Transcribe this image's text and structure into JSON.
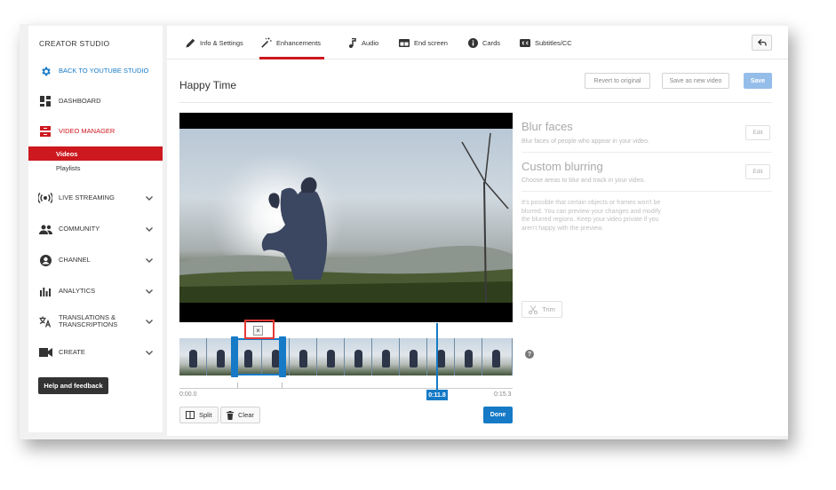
{
  "sidebar": {
    "title": "CREATOR STUDIO",
    "back_link": "BACK TO YOUTUBE STUDIO",
    "dashboard": "DASHBOARD",
    "video_manager": "VIDEO MANAGER",
    "videos": "Videos",
    "playlists": "Playlists",
    "live_streaming": "LIVE STREAMING",
    "community": "COMMUNITY",
    "channel": "CHANNEL",
    "analytics": "ANALYTICS",
    "translations_line1": "TRANSLATIONS &",
    "translations_line2": "TRANSCRIPTIONS",
    "create": "CREATE",
    "help": "Help and feedback"
  },
  "tabs": {
    "info": "Info & Settings",
    "enhancements": "Enhancements",
    "audio": "Audio",
    "end_screen": "End screen",
    "cards": "Cards",
    "subtitles": "Subtitles/CC"
  },
  "header": {
    "video_title": "Happy Time",
    "revert": "Revert to original",
    "save_as_new": "Save as new video",
    "save": "Save"
  },
  "editor": {
    "time_start": "0:00.0",
    "time_end": "0:15.3",
    "playhead_time": "0:11.8",
    "split": "Split",
    "clear": "Clear",
    "done": "Done",
    "remove_mark": "×"
  },
  "panel": {
    "blur_faces_title": "Blur faces",
    "blur_faces_desc": "Blur faces of people who appear in your video.",
    "custom_blur_title": "Custom blurring",
    "custom_blur_desc": "Choose areas to blur and track in your video.",
    "edit": "Edit",
    "note_line1": "It's possible that certain objects or frames won't be",
    "note_line2": "blurred. You can preview your changes and modify",
    "note_line3": "the blurred regions. Keep your video private if you",
    "note_line4": "aren't happy with the preview.",
    "trim": "Trim",
    "help_mark": "?"
  },
  "colors": {
    "accent_red": "#cc181e",
    "accent_blue": "#167ac6",
    "highlight": "#e53935"
  }
}
